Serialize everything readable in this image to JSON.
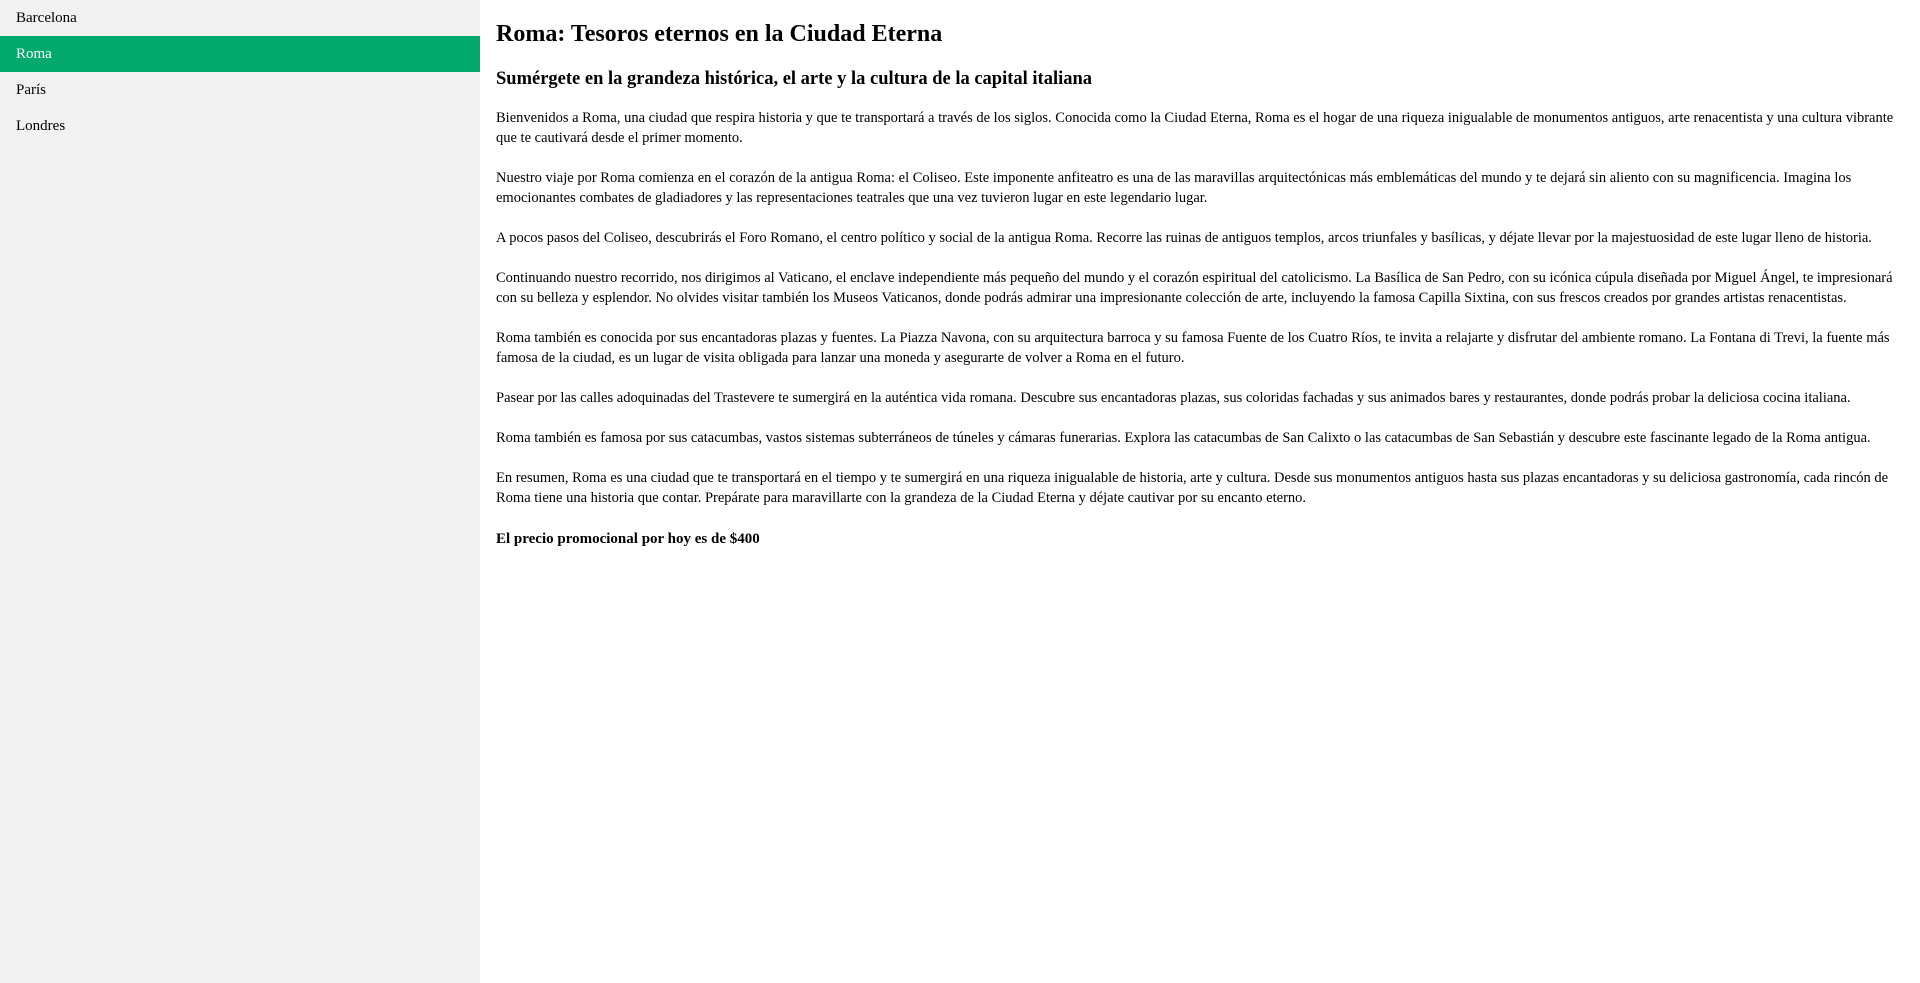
{
  "sidebar": {
    "items": [
      {
        "label": "Barcelona",
        "active": false
      },
      {
        "label": "Roma",
        "active": true
      },
      {
        "label": "París",
        "active": false
      },
      {
        "label": "Londres",
        "active": false
      }
    ]
  },
  "colors": {
    "sidebar_bg": "#f1f1f1",
    "active_bg": "#04aa6d",
    "active_text": "#ffffff"
  },
  "article": {
    "title": "Roma: Tesoros eternos en la Ciudad Eterna",
    "subtitle": "Sumérgete en la grandeza histórica, el arte y la cultura de la capital italiana",
    "paragraphs": [
      "Bienvenidos a Roma, una ciudad que respira historia y que te transportará a través de los siglos. Conocida como la Ciudad Eterna, Roma es el hogar de una riqueza inigualable de monumentos antiguos, arte renacentista y una cultura vibrante que te cautivará desde el primer momento.",
      "Nuestro viaje por Roma comienza en el corazón de la antigua Roma: el Coliseo. Este imponente anfiteatro es una de las maravillas arquitectónicas más emblemáticas del mundo y te dejará sin aliento con su magnificencia. Imagina los emocionantes combates de gladiadores y las representaciones teatrales que una vez tuvieron lugar en este legendario lugar.",
      "A pocos pasos del Coliseo, descubrirás el Foro Romano, el centro político y social de la antigua Roma. Recorre las ruinas de antiguos templos, arcos triunfales y basílicas, y déjate llevar por la majestuosidad de este lugar lleno de historia.",
      "Continuando nuestro recorrido, nos dirigimos al Vaticano, el enclave independiente más pequeño del mundo y el corazón espiritual del catolicismo. La Basílica de San Pedro, con su icónica cúpula diseñada por Miguel Ángel, te impresionará con su belleza y esplendor. No olvides visitar también los Museos Vaticanos, donde podrás admirar una impresionante colección de arte, incluyendo la famosa Capilla Sixtina, con sus frescos creados por grandes artistas renacentistas.",
      "Roma también es conocida por sus encantadoras plazas y fuentes. La Piazza Navona, con su arquitectura barroca y su famosa Fuente de los Cuatro Ríos, te invita a relajarte y disfrutar del ambiente romano. La Fontana di Trevi, la fuente más famosa de la ciudad, es un lugar de visita obligada para lanzar una moneda y asegurarte de volver a Roma en el futuro.",
      "Pasear por las calles adoquinadas del Trastevere te sumergirá en la auténtica vida romana. Descubre sus encantadoras plazas, sus coloridas fachadas y sus animados bares y restaurantes, donde podrás probar la deliciosa cocina italiana.",
      "Roma también es famosa por sus catacumbas, vastos sistemas subterráneos de túneles y cámaras funerarias. Explora las catacumbas de San Calixto o las catacumbas de San Sebastián y descubre este fascinante legado de la Roma antigua.",
      "En resumen, Roma es una ciudad que te transportará en el tiempo y te sumergirá en una riqueza inigualable de historia, arte y cultura. Desde sus monumentos antiguos hasta sus plazas encantadoras y su deliciosa gastronomía, cada rincón de Roma tiene una historia que contar. Prepárate para maravillarte con la grandeza de la Ciudad Eterna y déjate cautivar por su encanto eterno."
    ],
    "price_note": "El precio promocional por hoy es de $400"
  }
}
